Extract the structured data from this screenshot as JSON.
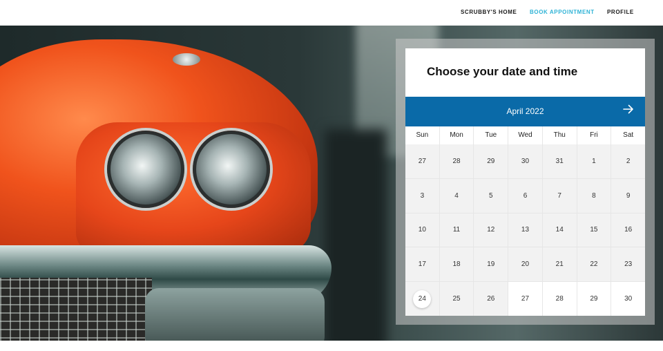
{
  "nav": {
    "home": "SCRUBBY'S HOME",
    "book": "BOOK APPOINTMENT",
    "profile": "PROFILE",
    "active_color": "#2fb3d6"
  },
  "booking": {
    "title": "Choose your date and time",
    "month": "April 2022",
    "next_icon": "arrow-right-icon",
    "header_color": "#0a6aa8",
    "weekdays": [
      "Sun",
      "Mon",
      "Tue",
      "Wed",
      "Thu",
      "Fri",
      "Sat"
    ],
    "weeks": [
      [
        "27",
        "28",
        "29",
        "30",
        "31",
        "1",
        "2"
      ],
      [
        "3",
        "4",
        "5",
        "6",
        "7",
        "8",
        "9"
      ],
      [
        "10",
        "11",
        "12",
        "13",
        "14",
        "15",
        "16"
      ],
      [
        "17",
        "18",
        "19",
        "20",
        "21",
        "22",
        "23"
      ],
      [
        "24",
        "25",
        "26",
        "27",
        "28",
        "29",
        "30"
      ]
    ],
    "today": "24"
  }
}
